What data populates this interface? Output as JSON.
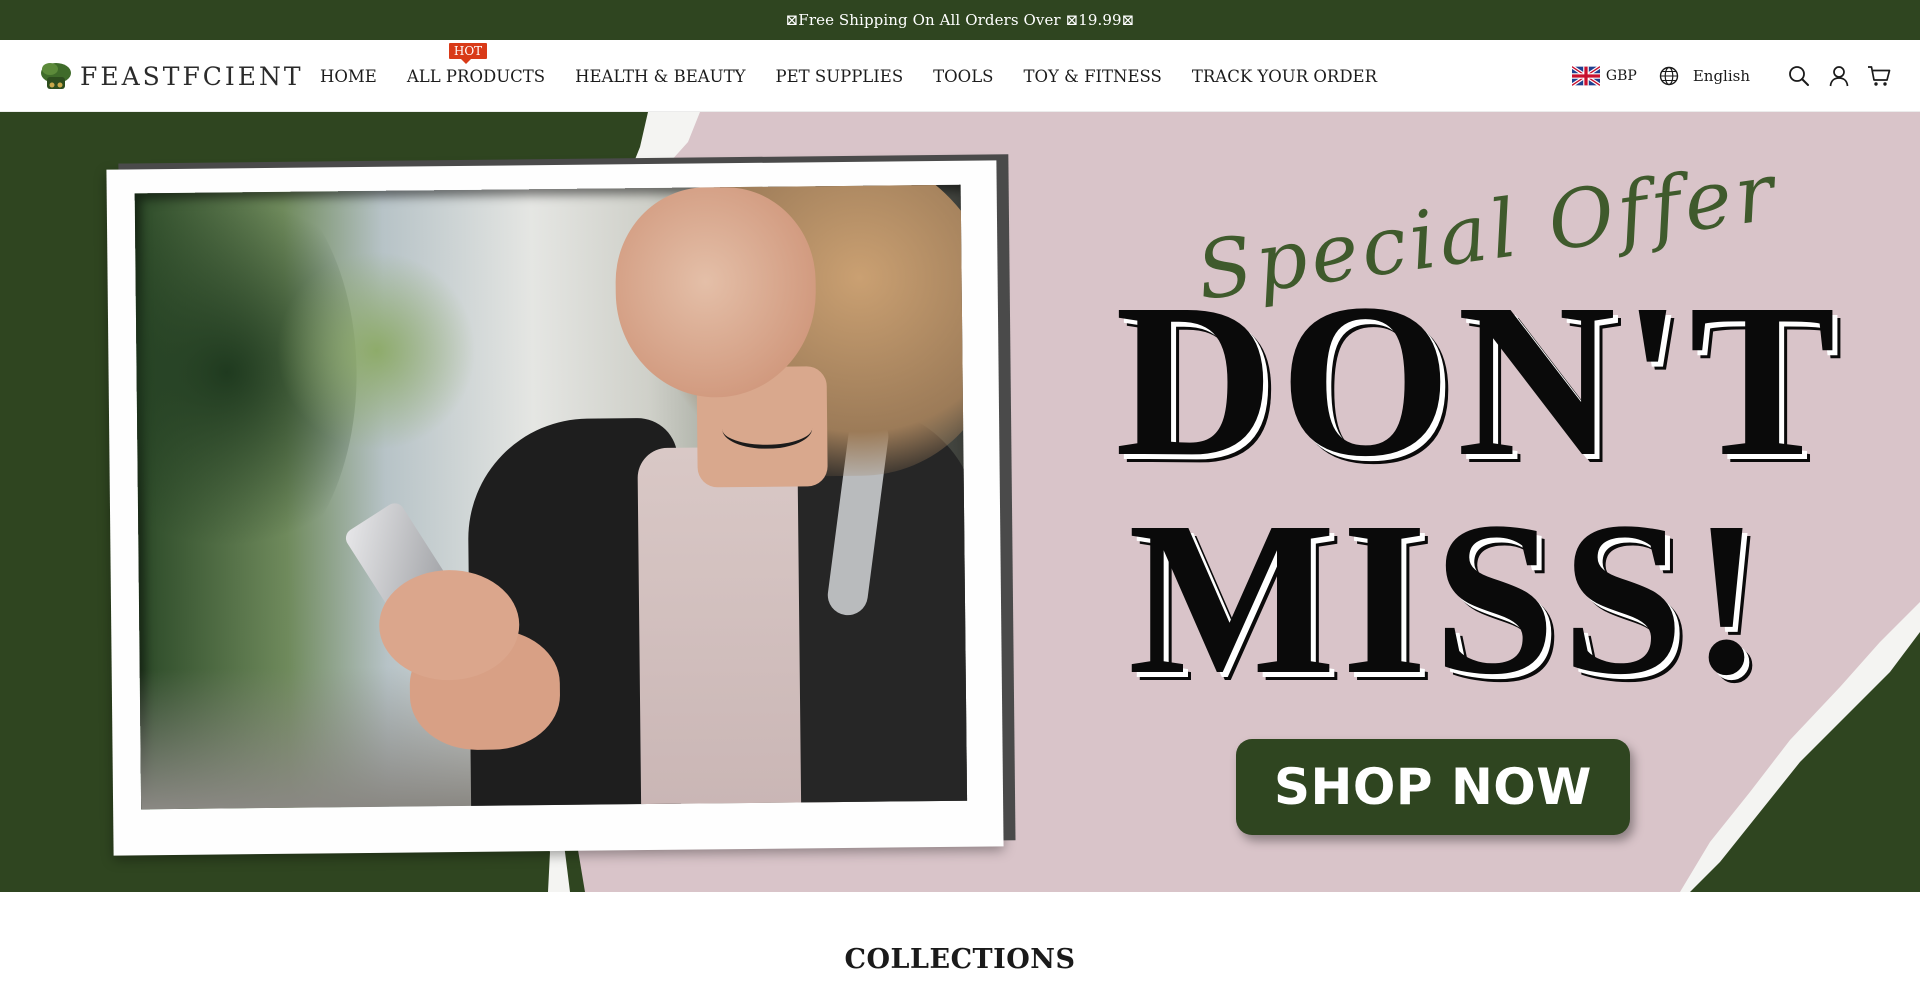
{
  "announcement": {
    "text": "⊠Free Shipping On All Orders Over ⊠19.99⊠"
  },
  "header": {
    "logo_text": "FEASTFCIENT",
    "nav": [
      {
        "label": "HOME"
      },
      {
        "label": "ALL PRODUCTS",
        "badge": "HOT"
      },
      {
        "label": "HEALTH & BEAUTY"
      },
      {
        "label": "PET SUPPLIES"
      },
      {
        "label": "TOOLS"
      },
      {
        "label": "TOY & FITNESS"
      },
      {
        "label": "TRACK YOUR ORDER"
      }
    ],
    "currency": "GBP",
    "currency_flag_icon": "uk-flag-icon",
    "language": "English",
    "icons": [
      "globe-icon",
      "search-icon",
      "account-icon",
      "cart-icon"
    ]
  },
  "hero": {
    "tagline": "Special Offer",
    "headline_line1": "DON'T",
    "headline_line2": "MISS!",
    "cta_label": "SHOP NOW"
  },
  "sections": {
    "collections_title": "COLLECTIONS"
  },
  "colors": {
    "brand_green": "#2f4520",
    "hero_pink": "#d9c4c9",
    "hot_badge": "#d93a18",
    "script_green": "#3f5a2c"
  }
}
